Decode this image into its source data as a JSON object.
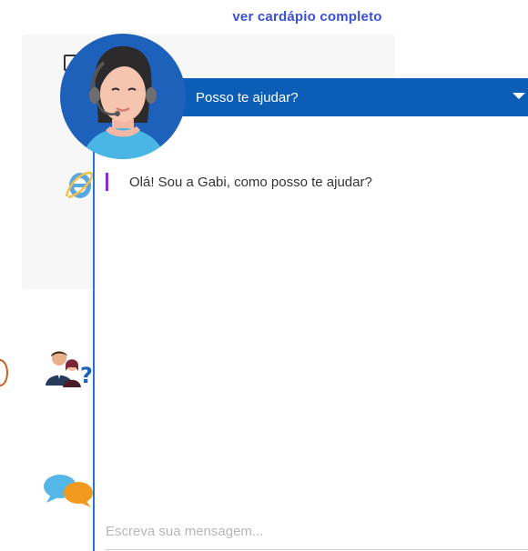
{
  "header": {
    "menu_link": "ver cardápio completo"
  },
  "chat": {
    "title": "Posso te ajudar?",
    "messages": [
      {
        "text": "Olá! Sou a Gabi, como posso te ajudar?"
      }
    ],
    "input": {
      "placeholder": "Escreva sua mensagem..."
    }
  },
  "icons": [
    "document-icon",
    "browser-icon",
    "support-people-icon",
    "chat-bubbles-icon",
    "chevron-down-icon"
  ],
  "colors": {
    "header_blue": "#0b5db5",
    "link_blue": "#3b50d8",
    "message_accent": "#8a2fd6",
    "avatar_bg": "#1d61bb"
  }
}
